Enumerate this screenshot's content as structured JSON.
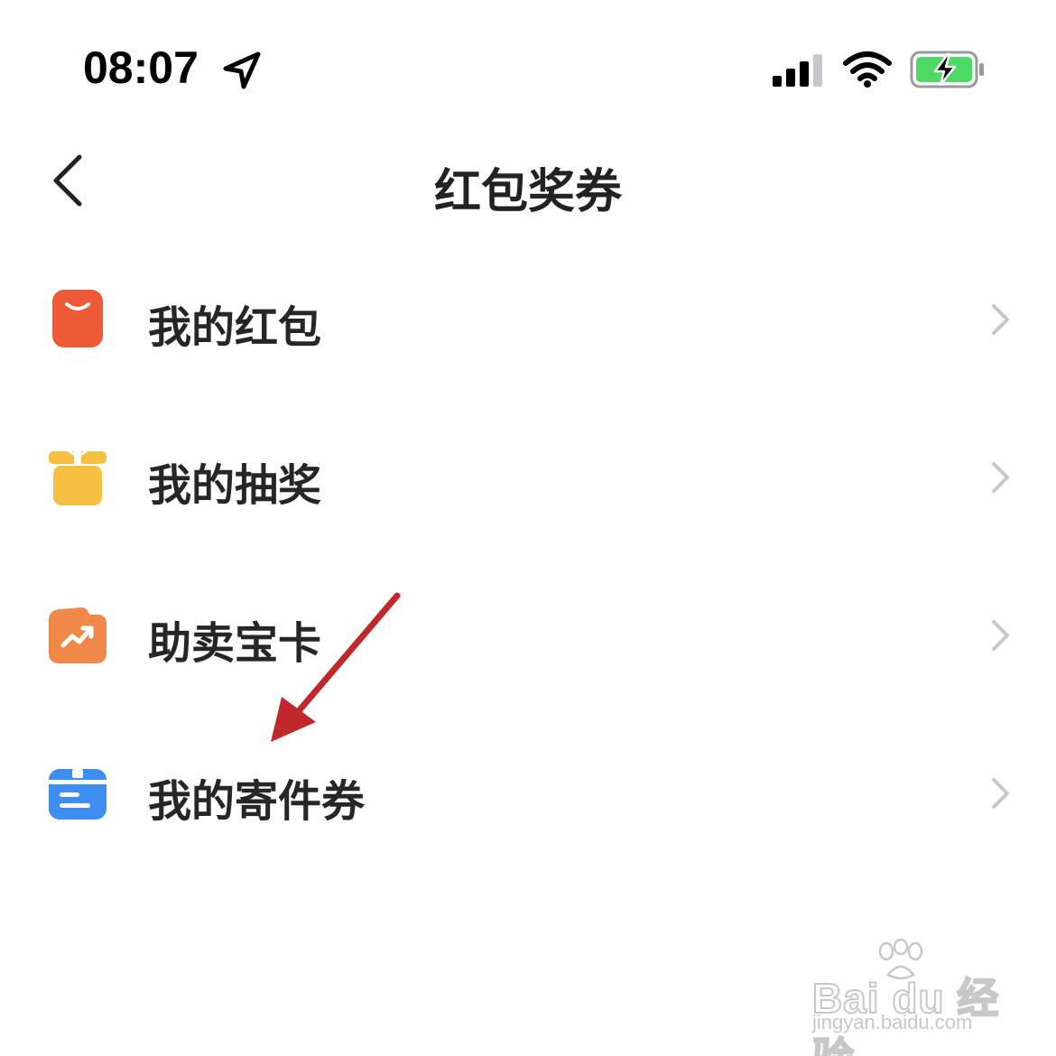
{
  "status_bar": {
    "time": "08:07",
    "icons": [
      "location-arrow-icon",
      "cellular-signal-icon",
      "wifi-icon",
      "battery-charging-icon"
    ],
    "battery_color": "#4cd964"
  },
  "nav": {
    "title": "红包奖券",
    "back_icon": "chevron-left-icon"
  },
  "menu": {
    "items": [
      {
        "label": "我的红包",
        "icon": "red-packet-icon",
        "color": "#ee5a38"
      },
      {
        "label": "我的抽奖",
        "icon": "gift-box-icon",
        "color": "#f6c042"
      },
      {
        "label": "助卖宝卡",
        "icon": "sales-boost-card-icon",
        "color": "#f0884a"
      },
      {
        "label": "我的寄件券",
        "icon": "shipping-coupon-icon",
        "color": "#3d8ef0"
      }
    ],
    "chevron_color": "#c8c8c8"
  },
  "annotation": {
    "arrow_color": "#c0282b"
  },
  "watermark": {
    "logo": "Bai du 经验",
    "url": "jingyan.baidu.com"
  }
}
